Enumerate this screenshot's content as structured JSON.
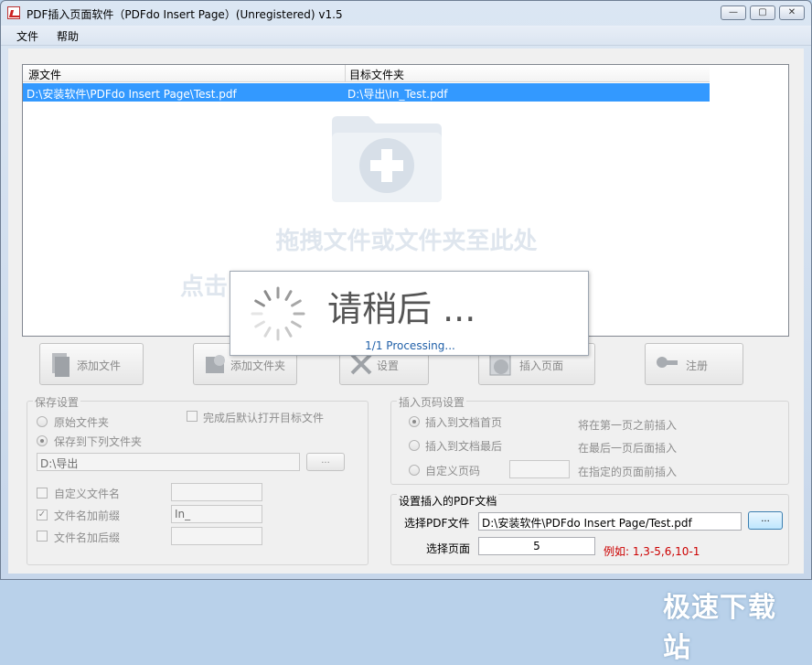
{
  "window": {
    "title": "PDF插入页面软件（PDFdo Insert Page）(Unregistered) v1.5",
    "minimize_label": "—",
    "maximize_label": "▢",
    "close_label": "✕"
  },
  "menu": {
    "items": [
      {
        "label": "文件"
      },
      {
        "label": "帮助"
      }
    ]
  },
  "file_list": {
    "columns": [
      "源文件",
      "目标文件夹"
    ],
    "rows": [
      {
        "source": "D:\\安装软件\\PDFdo Insert Page\\Test.pdf",
        "target": "D:\\导出\\In_Test.pdf"
      }
    ],
    "drop_hint_line1": "拖拽文件或文件夹至此处",
    "drop_hint_line2": "点击"
  },
  "toolbar": {
    "add_file": "添加文件",
    "add_folder": "添加文件夹",
    "settings": "设置",
    "insert_page": "插入页面",
    "register": "注册"
  },
  "save_settings": {
    "title": "保存设置",
    "original_folder": "原始文件夹",
    "save_to_folder": "保存到下列文件夹",
    "selected": "save_to_folder",
    "open_after_done": "完成后默认打开目标文件",
    "output_path": "D:\\导出",
    "browse_label": "...",
    "custom_filename": {
      "label": "自定义文件名",
      "checked": false,
      "value": ""
    },
    "prefix": {
      "label": "文件名加前缀",
      "checked": true,
      "value": "In_"
    },
    "suffix": {
      "label": "文件名加后缀",
      "checked": false,
      "value": ""
    }
  },
  "insert_position": {
    "title": "插入页码设置",
    "options": [
      {
        "label": "插入到文档首页",
        "desc": "将在第一页之前插入",
        "selected": true
      },
      {
        "label": "插入到文档最后",
        "desc": "在最后一页后面插入",
        "selected": false
      },
      {
        "label": "自定义页码",
        "desc": "在指定的页面前插入",
        "selected": false
      }
    ],
    "custom_page_value": ""
  },
  "insert_pdf": {
    "title": "设置插入的PDF文档",
    "select_file_label": "选择PDF文件",
    "file_path": "D:\\安装软件\\PDFdo Insert Page/Test.pdf",
    "browse_label": "...",
    "select_page_label": "选择页面",
    "page_value": "5",
    "example": "例如: 1,3-5,6,10-1"
  },
  "processing": {
    "message": "请稍后 ...",
    "progress": "1/1  Processing..."
  },
  "watermark": "极速下载站"
}
